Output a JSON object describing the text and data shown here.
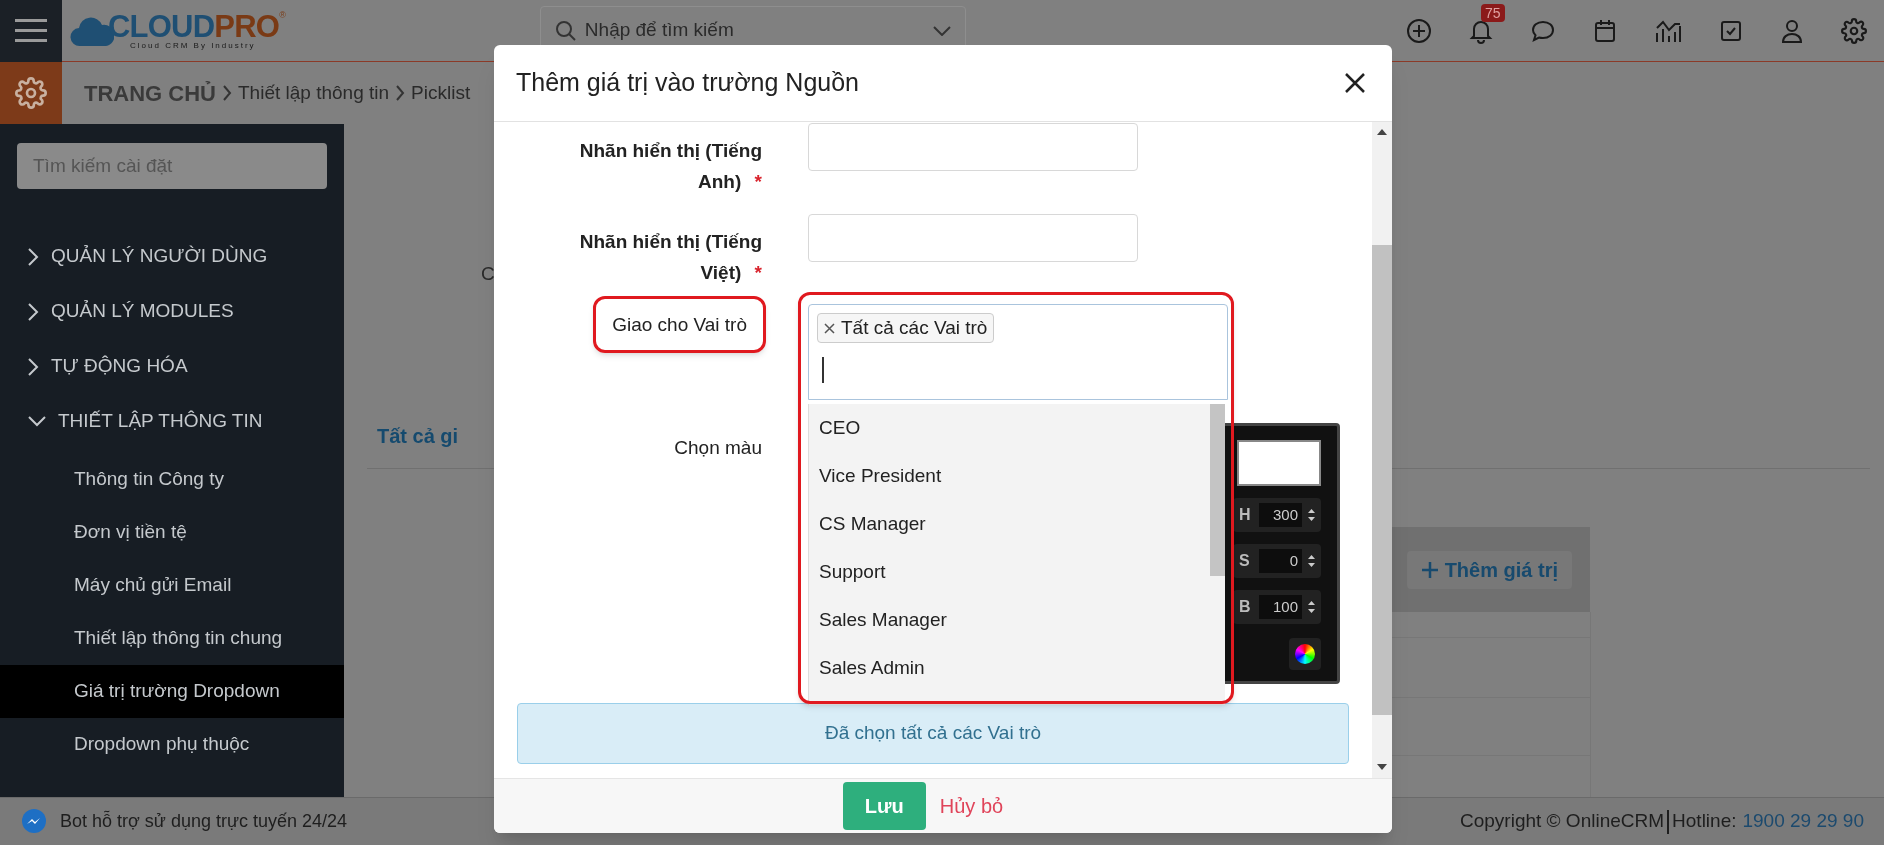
{
  "topbar": {
    "logo": {
      "primary": "CLOUD",
      "accent": "PRO",
      "mark": "®",
      "tagline": "Cloud CRM By Industry"
    },
    "search": {
      "placeholder": "Nhập để tìm kiếm"
    },
    "notification_count": "75"
  },
  "breadcrumb": [
    "TRANG CHỦ",
    "Thiết lập thông tin",
    "Picklist"
  ],
  "sidebar": {
    "search": {
      "placeholder": "Tìm kiếm cài đặt"
    },
    "sections": [
      {
        "label": "QUẢN LÝ NGƯỜI DÙNG",
        "expanded": false
      },
      {
        "label": "QUẢN LÝ MODULES",
        "expanded": false
      },
      {
        "label": "TỰ ĐỘNG HÓA",
        "expanded": false
      },
      {
        "label": "THIẾT LẬP THÔNG TIN",
        "expanded": true,
        "children": [
          {
            "label": "Thông tin Công ty",
            "selected": false
          },
          {
            "label": "Đơn vị tiền tệ",
            "selected": false
          },
          {
            "label": "Máy chủ gửi Email",
            "selected": false
          },
          {
            "label": "Thiết lập thông tin chung",
            "selected": false
          },
          {
            "label": "Giá trị trường Dropdown",
            "selected": true
          },
          {
            "label": "Dropdown phụ thuộc",
            "selected": false
          }
        ]
      }
    ]
  },
  "background": {
    "label_fragment": "C",
    "tab_fragment": "Tất cả gi",
    "add_button": "Thêm giá trị"
  },
  "modal": {
    "title": "Thêm giá trị vào trường Nguồn",
    "fields": [
      {
        "kind": "text",
        "label": "Nhãn hiển thị (Tiếng Anh)",
        "required_mark": "*",
        "highlighted": false
      },
      {
        "kind": "text",
        "label": "Nhãn hiển thị (Tiếng Việt)",
        "required_mark": "*",
        "highlighted": false
      },
      {
        "kind": "multiselect",
        "label": "Giao cho Vai trò",
        "highlighted": true,
        "tags": [
          "Tất cả các Vai trò"
        ],
        "options": [
          "CEO",
          "Vice President",
          "CS Manager",
          "Support",
          "Sales Manager",
          "Sales Admin"
        ]
      },
      {
        "kind": "color",
        "label": "Chọn màu",
        "highlighted": false,
        "hsb": [
          {
            "name": "H",
            "value": "300"
          },
          {
            "name": "S",
            "value": "0"
          },
          {
            "name": "B",
            "value": "100"
          }
        ]
      }
    ],
    "alert": "Đã chọn tất cả các Vai trò",
    "save": "Lưu",
    "cancel": "Hủy bỏ"
  },
  "footer": {
    "bot": "Bot hỗ trợ sử dụng trực tuyến 24/24",
    "copyright": "Copyright © OnlineCRM",
    "hotline_label": "Hotline:",
    "hotline": "1900 29 29 90"
  }
}
